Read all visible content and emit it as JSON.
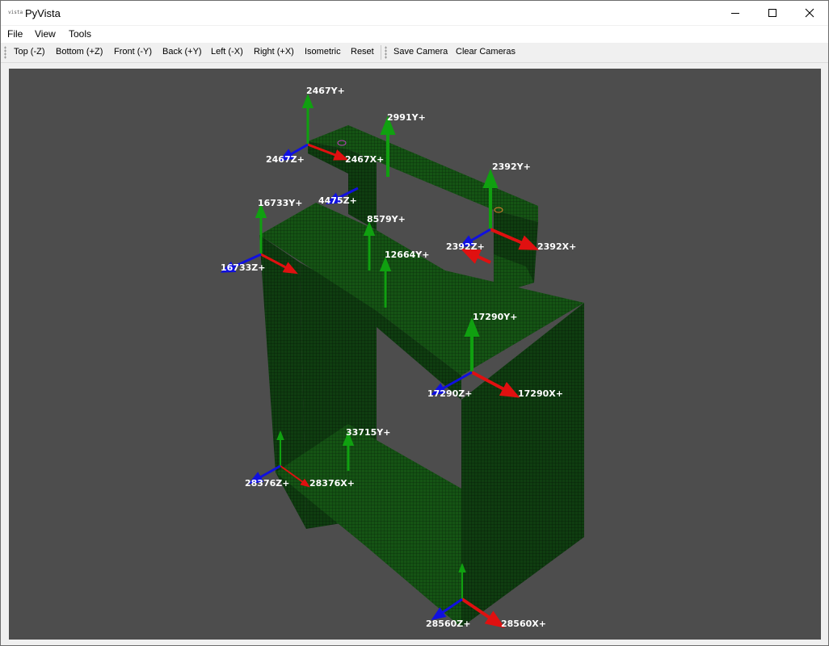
{
  "window": {
    "title": "PyVista",
    "app_icon_text": "vista"
  },
  "menu": {
    "file": "File",
    "view": "View",
    "tools": "Tools"
  },
  "toolbar": {
    "top": "Top (-Z)",
    "bottom": "Bottom (+Z)",
    "front": "Front (-Y)",
    "back": "Back (+Y)",
    "left": "Left (-X)",
    "right": "Right (+X)",
    "isometric": "Isometric",
    "reset": "Reset",
    "save_camera": "Save Camera",
    "clear_cameras": "Clear Cameras"
  },
  "scene": {
    "background": "#4d4d4d",
    "mesh_color": "#0f3d10",
    "axis_colors": {
      "x": "#e01010",
      "y": "#10a010",
      "z": "#1010e0"
    },
    "labels": {
      "l2467y": "2467Y+",
      "l2467z": "2467Z+",
      "l2467x": "2467X+",
      "l2991y": "2991Y+",
      "l4475z": "4475Z+",
      "l2392y": "2392Y+",
      "l2392z": "2392Z+",
      "l2392x": "2392X+",
      "l16733y": "16733Y+",
      "l16733z": "16733Z+",
      "l8579y": "8579Y+",
      "l12664y": "12664Y+",
      "l17290y": "17290Y+",
      "l17290z": "17290Z+",
      "l17290x": "17290X+",
      "l33715y": "33715Y+",
      "l28376z": "28376Z+",
      "l28376x": "28376X+",
      "l28560z": "28560Z+",
      "l28560x": "28560X+"
    }
  }
}
